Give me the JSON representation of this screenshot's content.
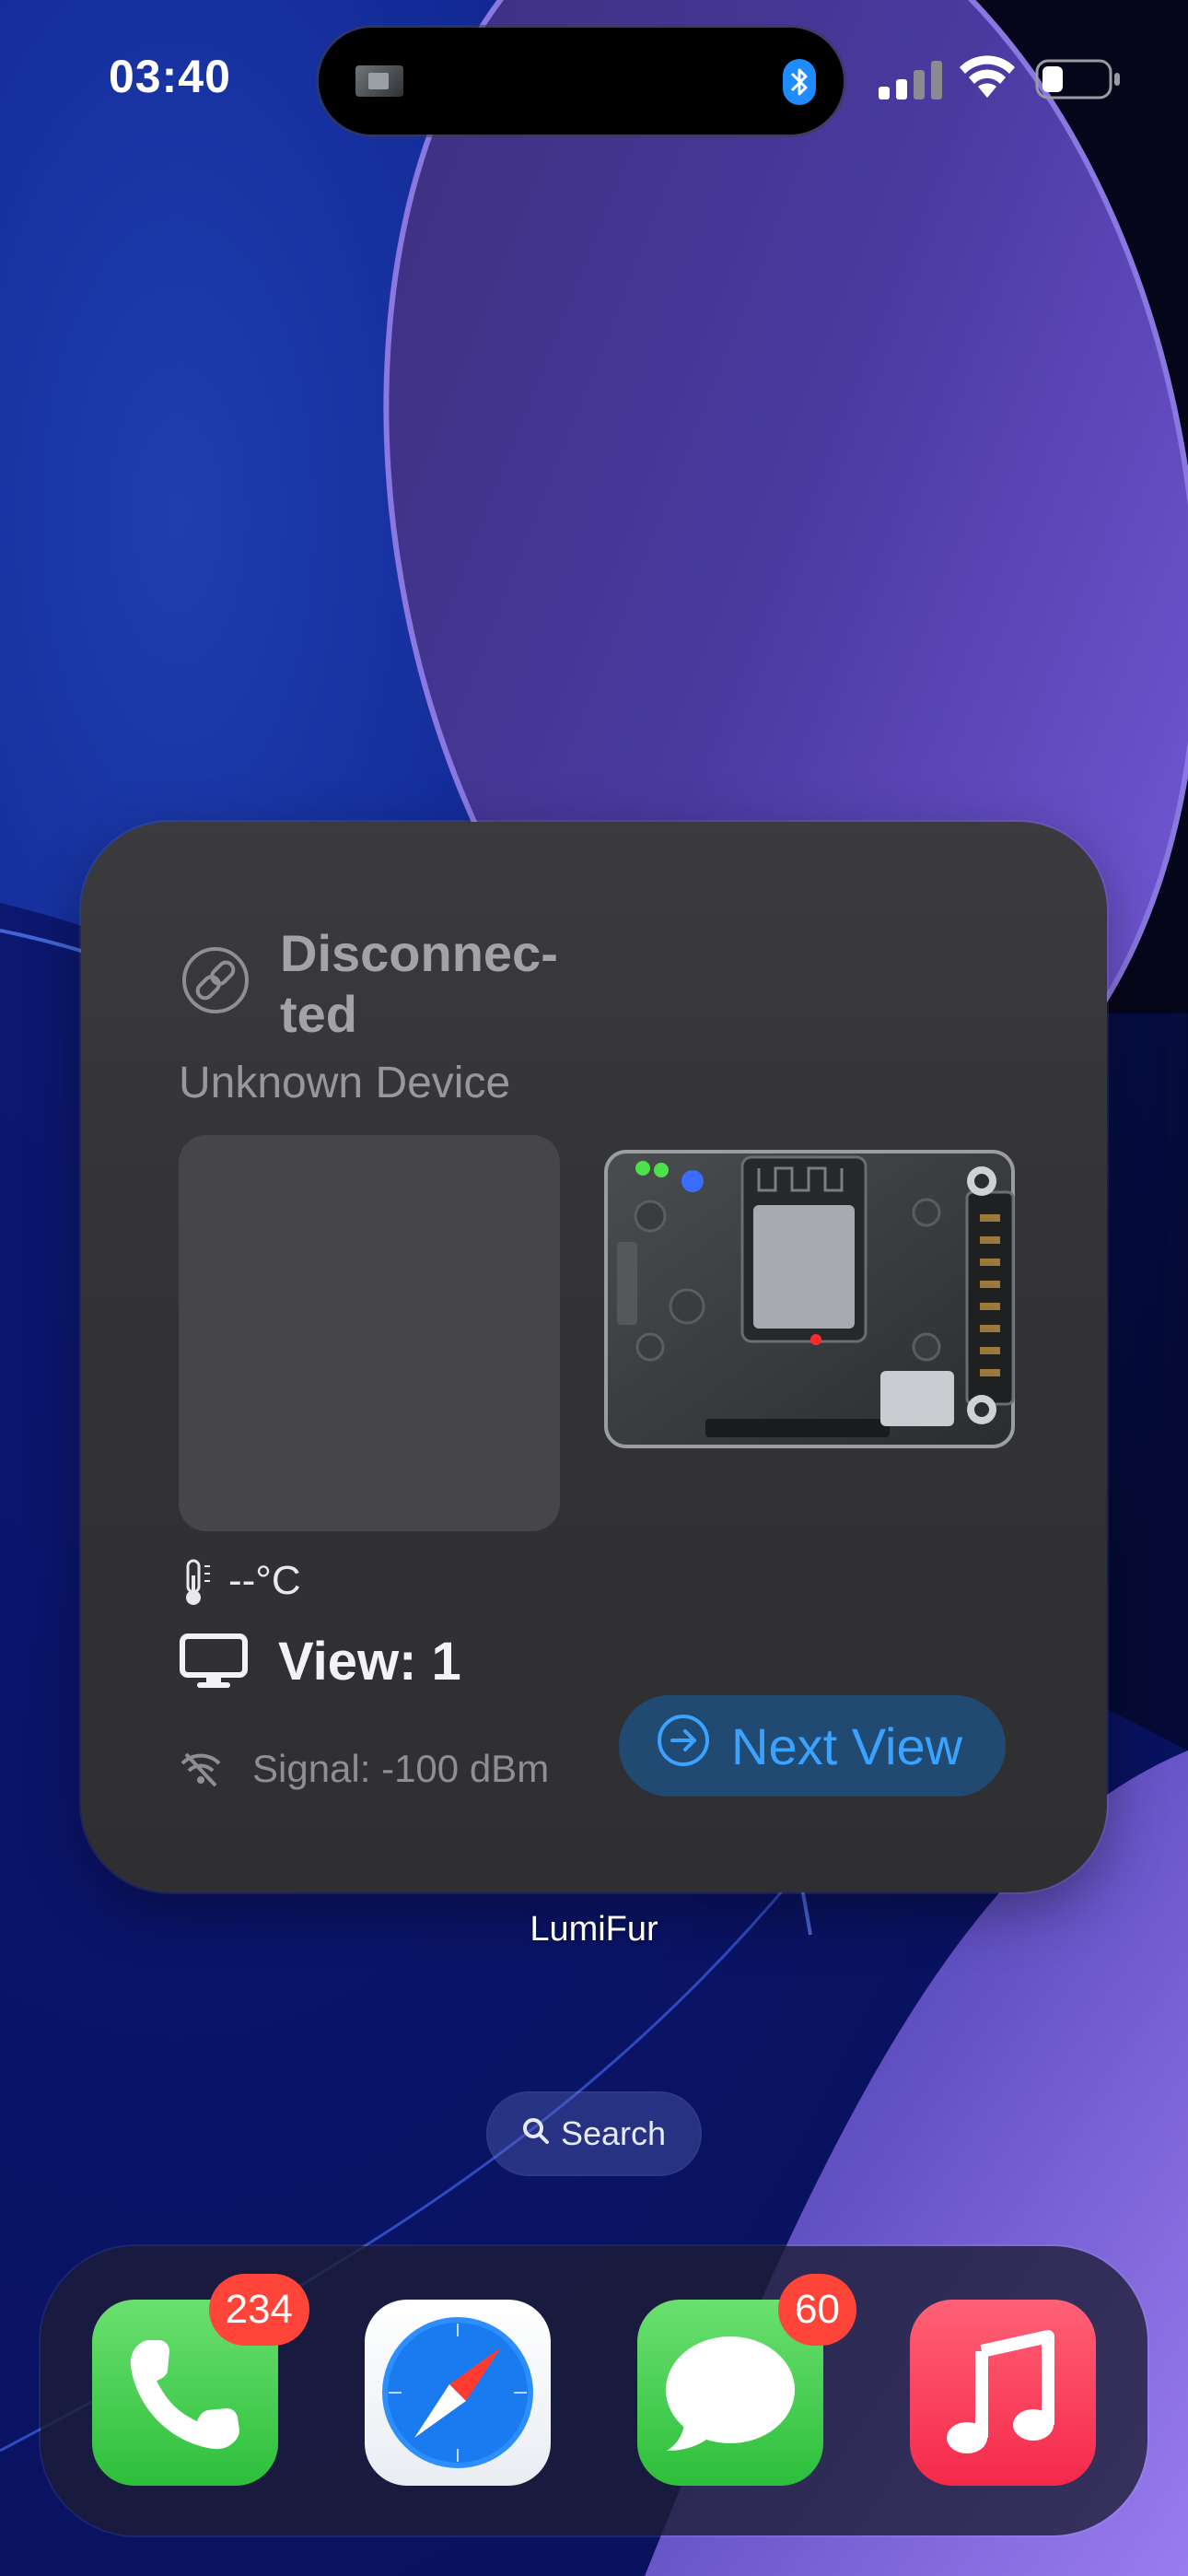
{
  "status_bar": {
    "time": "03:40"
  },
  "widget": {
    "status": "Disconnec-ted",
    "device_name": "Unknown Device",
    "temperature": "--°C",
    "view": "View: 1",
    "signal": "Signal: -100 dBm",
    "next_view_label": "Next View",
    "app_label": "LumiFur"
  },
  "search": {
    "label": "Search"
  },
  "dock": {
    "apps": [
      {
        "name": "Phone",
        "icon": "phone-icon",
        "badge": "234"
      },
      {
        "name": "Safari",
        "icon": "compass-icon",
        "badge": ""
      },
      {
        "name": "Messages",
        "icon": "message-bubble-icon",
        "badge": "60"
      },
      {
        "name": "Music",
        "icon": "music-note-icon",
        "badge": ""
      }
    ]
  },
  "colors": {
    "accent_blue": "#3ba2ff",
    "badge_red": "#ff4539",
    "widget_bg": "#333336",
    "dock_green": "#2dbf3b",
    "music_red": "#f5294a"
  }
}
